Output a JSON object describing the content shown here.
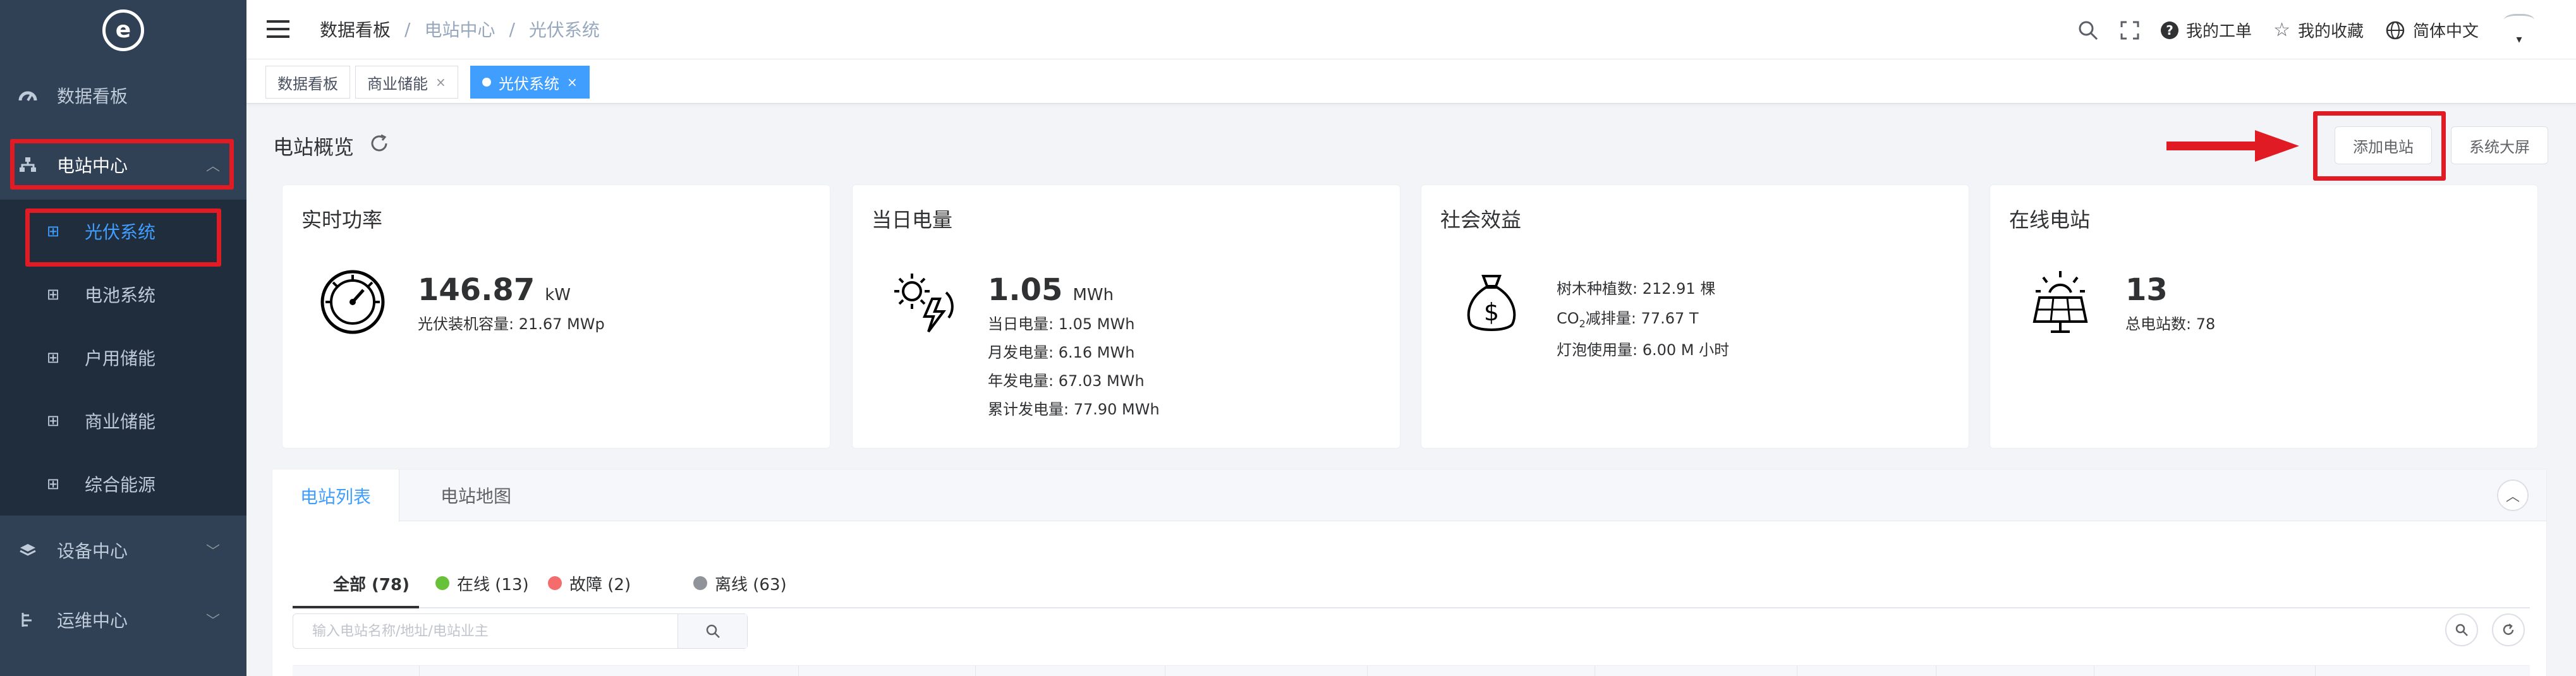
{
  "sidebar": {
    "items": [
      {
        "label": "数据看板",
        "icon": "dashboard-icon"
      },
      {
        "label": "电站中心",
        "icon": "sitemap-icon",
        "expanded": true
      },
      {
        "label": "设备中心",
        "icon": "layers-icon"
      },
      {
        "label": "运维中心",
        "icon": "tools-icon"
      }
    ],
    "submenu": [
      {
        "label": "光伏系统",
        "active": true
      },
      {
        "label": "电池系统"
      },
      {
        "label": "户用储能"
      },
      {
        "label": "商业储能"
      },
      {
        "label": "综合能源"
      }
    ]
  },
  "header": {
    "breadcrumb": [
      "数据看板",
      "电站中心",
      "光伏系统"
    ],
    "separator": "/",
    "my_tickets": "我的工单",
    "favorites": "我的收藏",
    "language": "简体中文"
  },
  "tags": [
    {
      "label": "数据看板"
    },
    {
      "label": "商业储能",
      "closable": true
    },
    {
      "label": "光伏系统",
      "closable": true,
      "active": true
    }
  ],
  "overview": {
    "title": "电站概览",
    "add_station": "添加电站",
    "big_screen": "系统大屏"
  },
  "cards": {
    "realtime_power": {
      "title": "实时功率",
      "value": "146.87",
      "unit": "kW",
      "capacity": "光伏装机容量: 21.67 MWp"
    },
    "daily_energy": {
      "title": "当日电量",
      "value": "1.05",
      "unit": "MWh",
      "lines": [
        "当日电量: 1.05 MWh",
        "月发电量: 6.16 MWh",
        "年发电量: 67.03 MWh",
        "累计发电量: 77.90 MWh"
      ]
    },
    "social_benefit": {
      "title": "社会效益",
      "trees": "树木种植数: 212.91 棵",
      "co2_prefix": "CO",
      "co2_sub": "2",
      "co2_suffix": "减排量: 77.67 T",
      "bulbs": "灯泡使用量: 6.00 M 小时"
    },
    "online_stations": {
      "title": "在线电站",
      "value": "13",
      "total": "总电站数: 78"
    }
  },
  "panel": {
    "tabs": [
      "电站列表",
      "电站地图"
    ],
    "filters": [
      {
        "label": "全部 (78)",
        "color": ""
      },
      {
        "label": "在线 (13)",
        "color": "#67c23a"
      },
      {
        "label": "故障 (2)",
        "color": "#f56c6c"
      },
      {
        "label": "离线 (63)",
        "color": "#909399"
      }
    ],
    "search_placeholder": "输入电站名称/地址/电站业主"
  },
  "colors": {
    "sidebar_bg": "#304156",
    "accent": "#409eff",
    "highlight": "#e01b24"
  }
}
